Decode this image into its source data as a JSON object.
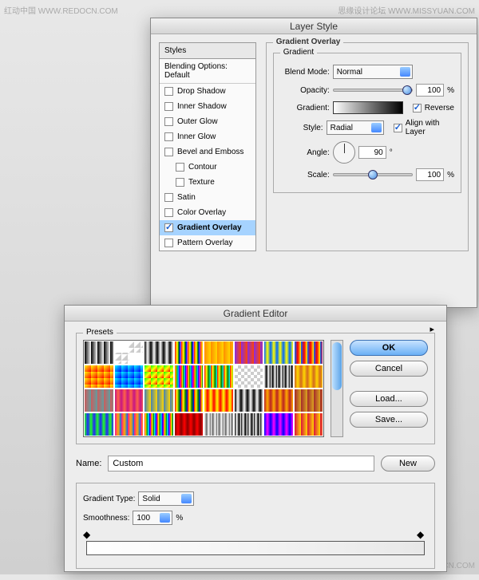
{
  "watermarks": {
    "topLeft": "红动中国 WWW.REDOCN.COM",
    "topRight": "思缘设计论坛 WWW.MISSYUAN.COM",
    "bottomRight": "红动中国 WWW.REDOCN.COM"
  },
  "layerStyle": {
    "title": "Layer Style",
    "stylesHeader": "Styles",
    "blendingHeader": "Blending Options: Default",
    "items": [
      {
        "label": "Drop Shadow",
        "on": false
      },
      {
        "label": "Inner Shadow",
        "on": false
      },
      {
        "label": "Outer Glow",
        "on": false
      },
      {
        "label": "Inner Glow",
        "on": false
      },
      {
        "label": "Bevel and Emboss",
        "on": false
      },
      {
        "label": "Contour",
        "on": false,
        "indent": true
      },
      {
        "label": "Texture",
        "on": false,
        "indent": true
      },
      {
        "label": "Satin",
        "on": false
      },
      {
        "label": "Color Overlay",
        "on": false
      },
      {
        "label": "Gradient Overlay",
        "on": true,
        "sel": true
      },
      {
        "label": "Pattern Overlay",
        "on": false
      }
    ],
    "panel": {
      "title": "Gradient Overlay",
      "groupTitle": "Gradient",
      "blendModeLabel": "Blend Mode:",
      "blendModeValue": "Normal",
      "opacityLabel": "Opacity:",
      "opacityValue": "100",
      "gradientLabel": "Gradient:",
      "reverseLabel": "Reverse",
      "reverseOn": true,
      "styleLabel": "Style:",
      "styleValue": "Radial",
      "alignLabel": "Align with Layer",
      "alignOn": true,
      "angleLabel": "Angle:",
      "angleValue": "90",
      "scaleLabel": "Scale:",
      "scaleValue": "100",
      "pct": "%"
    }
  },
  "gradEditor": {
    "title": "Gradient Editor",
    "presetsLabel": "Presets",
    "buttons": {
      "ok": "OK",
      "cancel": "Cancel",
      "load": "Load...",
      "save": "Save..."
    },
    "nameLabel": "Name:",
    "nameValue": "Custom",
    "newBtn": "New",
    "gradTypeLabel": "Gradient Type:",
    "gradTypeValue": "Solid",
    "smoothLabel": "Smoothness:",
    "smoothValue": "100",
    "pct": "%",
    "presetGradients": [
      "linear-gradient(to right,#000,#fff)",
      "linear-gradient(135deg,#fff 45%,transparent 55%),repeating-conic-gradient(#ccc 0 25%,#fff 0 50%)",
      "linear-gradient(to right,#000,#fff 50%,#000)",
      "linear-gradient(to right,red,orange,yellow,green,blue,violet)",
      "linear-gradient(to right,#ff8c00,#ffd700)",
      "linear-gradient(to right,#8a2be2,#ff4500)",
      "linear-gradient(to right,#0066ff,#ffff00,#0066ff)",
      "linear-gradient(to right,#0066ff,#ff0000,#ffff00)",
      "linear-gradient(135deg,#ff0,#f00)",
      "linear-gradient(135deg,#0ff,#00f)",
      "linear-gradient(135deg,#0f0,#ff0,#f00)",
      "linear-gradient(to right,red,yellow,green,cyan,blue,magenta,red)",
      "linear-gradient(to right,red,yellow,green,cyan)",
      "repeating-conic-gradient(#ccc 0 25%,#fff 0 50%)",
      "linear-gradient(to right,#fff,#000,#fff,#000)",
      "linear-gradient(to right,#d2691e,#ffd700,#d2691e)",
      "linear-gradient(to right,#cd5c5c,#5f9ea0)",
      "linear-gradient(to right,#c71585,#ff6347,#c71585)",
      "linear-gradient(to right,#4682b4,#ffd700)",
      "linear-gradient(to right,red,yellow,green,blue)",
      "linear-gradient(to right,yellow,red,yellow)",
      "linear-gradient(to right,#000,#fff,#000)",
      "linear-gradient(to right,#b22,#fa0,#b22)",
      "linear-gradient(to right,#a52a2a,#daa520)",
      "linear-gradient(to right,#2f2,#22f,#2f2)",
      "linear-gradient(to right,#ff1493,#fa0,#06f)",
      "linear-gradient(to right,red,yellow,green,cyan,blue,magenta)",
      "linear-gradient(to right,#800,#f00,#800)",
      "linear-gradient(to right,#fff,#666,#fff,#666)",
      "linear-gradient(to right,#000,#fff,#000,#fff)",
      "linear-gradient(to right,#00f,#f0f,#00f)",
      "linear-gradient(to right,#dc143c,#ffd700)"
    ]
  }
}
